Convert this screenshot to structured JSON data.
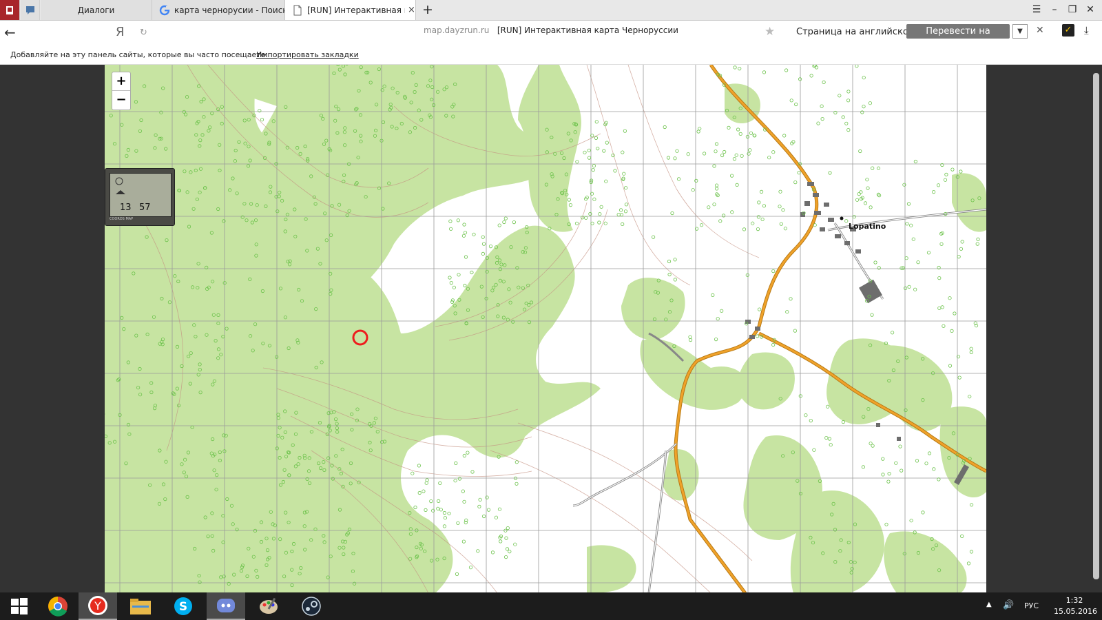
{
  "browser": {
    "tabs": [
      {
        "title": "Диалоги",
        "icon": "message-icon"
      },
      {
        "title": "карта чернорусии - Поиск",
        "icon": "google-icon"
      },
      {
        "title": "[RUN] Интерактивная ка",
        "icon": "page-icon"
      }
    ],
    "new_tab": "+",
    "address": {
      "host": "map.dayzrun.ru",
      "title": "[RUN] Интерактивная карта Чернорусcии"
    },
    "search_engine": "Я",
    "translate": {
      "label": "Страница на английском",
      "button": "Перевести на русский"
    },
    "bookmarks_bar": {
      "text": "Добавляйте на эту панель сайты, которые вы часто посещаете.",
      "link": "Импортировать закладки"
    }
  },
  "map": {
    "zoom_in": "+",
    "zoom_out": "−",
    "gps": {
      "x": "13",
      "y": "57",
      "bar": "COORDS  MAP"
    },
    "town_label": "Lopatino",
    "colors": {
      "forest": "#c7e4a2",
      "road_main": "#f0a22a",
      "road_edge": "#b77a16",
      "grid": "#9a9a9a",
      "contour": "#c49080",
      "marker": "#ee1c1c"
    }
  },
  "taskbar": {
    "apps": [
      "windows-icon",
      "chrome-icon",
      "yandex-browser-icon",
      "file-explorer-icon",
      "skype-icon",
      "discord-icon",
      "paint-icon",
      "steam-icon"
    ],
    "lang": "РУС",
    "time": "1:32",
    "date": "15.05.2016"
  }
}
